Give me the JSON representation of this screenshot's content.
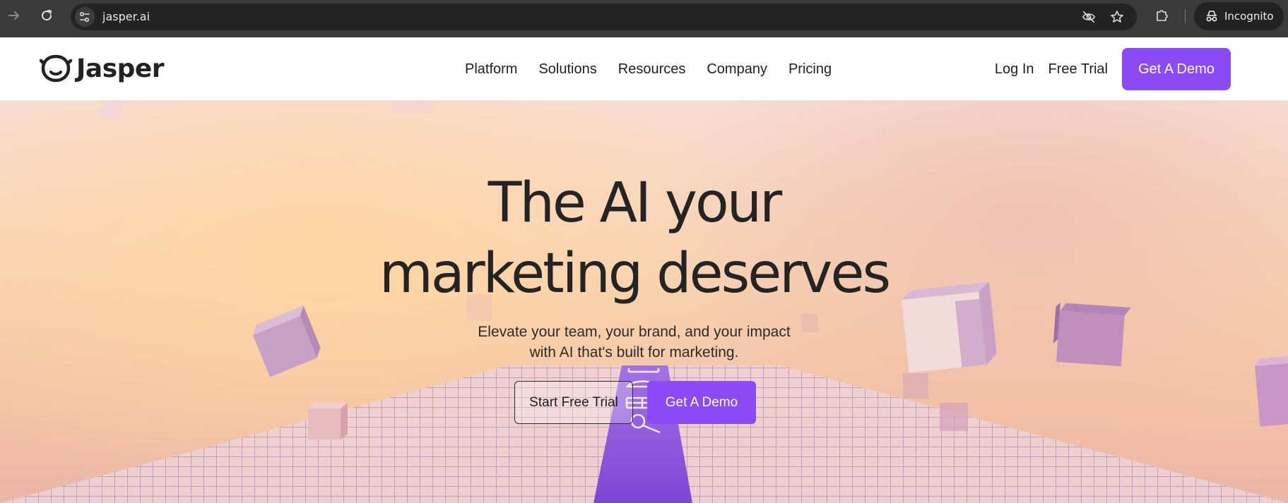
{
  "browser": {
    "url": "jasper.ai",
    "incognito_label": "Incognito",
    "icons": {
      "forward": "arrow-right-icon",
      "reload": "reload-icon",
      "site_info": "tune-icon",
      "eye_off": "eye-off-icon",
      "bookmark": "star-icon",
      "extensions": "puzzle-icon",
      "incognito": "incognito-icon"
    }
  },
  "header": {
    "logo_text": "Jasper",
    "nav": [
      {
        "label": "Platform"
      },
      {
        "label": "Solutions"
      },
      {
        "label": "Resources"
      },
      {
        "label": "Company"
      },
      {
        "label": "Pricing"
      }
    ],
    "login_label": "Log In",
    "free_trial_label": "Free Trial",
    "demo_label": "Get A Demo"
  },
  "hero": {
    "title_lines": [
      "The AI your",
      "marketing deserves"
    ],
    "subtitle_lines": [
      "Elevate your team, your brand, and your impact",
      "with AI that's built for marketing."
    ],
    "cta_trial": "Start Free Trial",
    "cta_demo": "Get A Demo"
  },
  "colors": {
    "accent": "#8c4af6",
    "text": "#242424",
    "chrome_bg": "#3a3a3a"
  }
}
